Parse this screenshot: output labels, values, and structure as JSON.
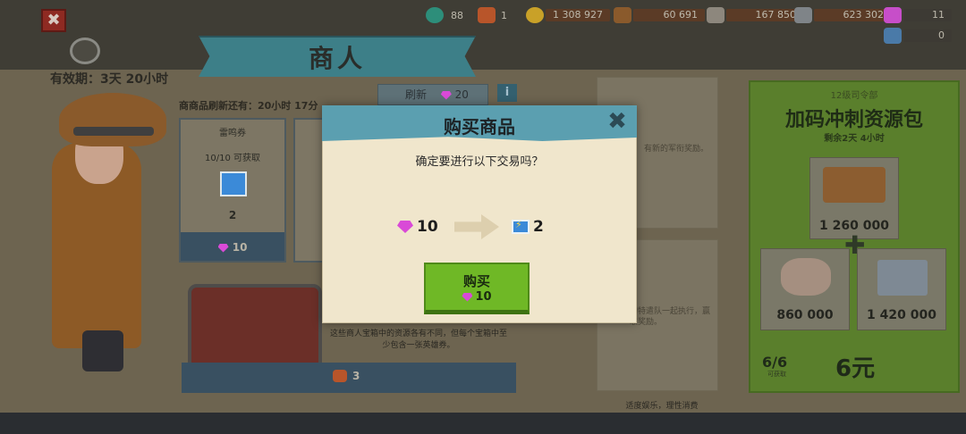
{
  "topbar": {
    "gems_small": "88",
    "tickets_small": "1",
    "gold": "1 308 927",
    "wood": "60 691",
    "stone": "167 850",
    "iron": "623 302",
    "diamonds": "11",
    "hero_tokens": "0"
  },
  "header": {
    "title": "商人",
    "expiry_label": "有效期：3天 20小时",
    "close_label": "✖"
  },
  "shop": {
    "refresh_note": "商商品刷新还有：20小时 17分",
    "refresh_label": "刷新",
    "refresh_cost": "20",
    "info_label": "i",
    "card1_title": "雷鸣券",
    "card1_stock": "10/10 可获取",
    "card1_qty": "2",
    "card1_price": "10",
    "chest_desc": "这些商人宝箱中的资源各有不同，但每个宝箱中至少包含一张英雄券。",
    "chest_price": "3",
    "side1_text": "有新的军衔奖励。",
    "side2_text": "的特遣队一起执行，赢取奖励。",
    "footnote": "适度娱乐，理性消费"
  },
  "offer": {
    "subtitle": "12级司令部",
    "title": "加码冲刺资源包",
    "time_left": "剩余2天 4小时",
    "wood_amount": "1 260 000",
    "stone_amount": "860 000",
    "iron_amount": "1 420 000",
    "stock": "6/6",
    "stock_label": "可获取",
    "price": "6元"
  },
  "modal": {
    "title": "购买商品",
    "close": "✖",
    "question": "确定要进行以下交易吗？",
    "pay_amount": "10",
    "receive_amount": "2",
    "buy_label": "购买",
    "buy_cost": "10"
  },
  "colors": {
    "modal_header": "#5b9fb0",
    "buy_button": "#6fb826",
    "offer_panel": "#5a7f2c",
    "gem": "#d94ad7",
    "ticket": "#3b8ad8"
  }
}
